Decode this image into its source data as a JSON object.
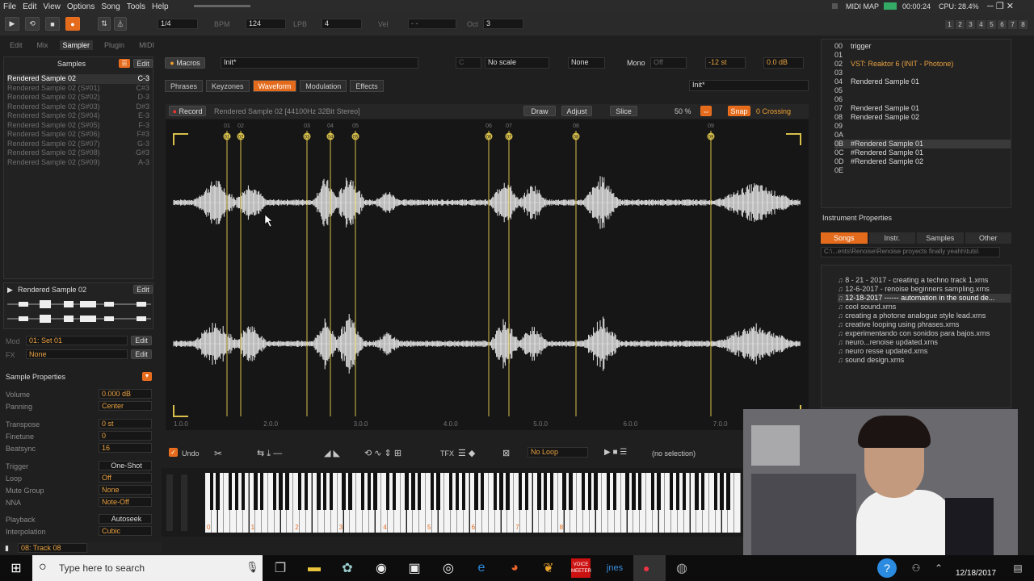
{
  "menu": [
    "File",
    "Edit",
    "View",
    "Options",
    "Song",
    "Tools",
    "Help"
  ],
  "transport": {
    "pattern": "1/4",
    "bpm_label": "BPM",
    "bpm": "124",
    "lpb_label": "LPB",
    "lpb": "4",
    "vel_label": "Vel",
    "vel": "- -",
    "oct_label": "Oct",
    "oct": "3",
    "midi_map": "MIDI MAP",
    "time": "00:00:24",
    "cpu": "CPU: 28.4%"
  },
  "track_numbers": [
    "1",
    "2",
    "3",
    "4",
    "5",
    "6",
    "7",
    "8"
  ],
  "left_tabs": [
    "Edit",
    "Mix",
    "Sampler",
    "Plugin",
    "MIDI"
  ],
  "samples_header": "Samples",
  "samples_edit": "Edit",
  "samples": [
    {
      "name": "Rendered Sample 02",
      "note": "C-3"
    },
    {
      "name": "Rendered Sample 02 (S#01)",
      "note": "C#3"
    },
    {
      "name": "Rendered Sample 02 (S#02)",
      "note": "D-3"
    },
    {
      "name": "Rendered Sample 02 (S#03)",
      "note": "D#3"
    },
    {
      "name": "Rendered Sample 02 (S#04)",
      "note": "E-3"
    },
    {
      "name": "Rendered Sample 02 (S#05)",
      "note": "F-3"
    },
    {
      "name": "Rendered Sample 02 (S#06)",
      "note": "F#3"
    },
    {
      "name": "Rendered Sample 02 (S#07)",
      "note": "G-3"
    },
    {
      "name": "Rendered Sample 02 (S#08)",
      "note": "G#3"
    },
    {
      "name": "Rendered Sample 02 (S#09)",
      "note": "A-3"
    }
  ],
  "preview": {
    "name": "Rendered Sample 02",
    "edit": "Edit"
  },
  "mod": {
    "label": "Mod",
    "value": "01: Set 01",
    "edit": "Edit"
  },
  "fx": {
    "label": "FX",
    "value": "None",
    "edit": "Edit"
  },
  "sample_props": {
    "title": "Sample Properties",
    "volume_l": "Volume",
    "volume": "0.000 dB",
    "panning_l": "Panning",
    "panning": "Center",
    "transpose_l": "Transpose",
    "transpose": "0 st",
    "finetune_l": "Finetune",
    "finetune": "0",
    "beatsync_l": "Beatsync",
    "beatsync": "16",
    "beatsync_t": "T",
    "trigger_l": "Trigger",
    "trigger": "One-Shot",
    "loop_l": "Loop",
    "loop": "Off",
    "mute_l": "Mute Group",
    "mute": "None",
    "nna_l": "NNA",
    "nna": "Note-Off",
    "playback_l": "Playback",
    "playback": "Autoseek",
    "interp_l": "Interpolation",
    "interp": "Cubic"
  },
  "instr_bar": {
    "macros": "Macros",
    "preset": "Init*",
    "scale_key": "C",
    "scale": "No scale",
    "none": "None",
    "mono": "Mono",
    "glide": "Off",
    "tune": "-12 st",
    "gain": "0.0 dB"
  },
  "sampler_tabs": [
    "Phrases",
    "Keyzones",
    "Waveform",
    "Modulation",
    "Effects"
  ],
  "sampler_preset": "Init*",
  "wave_toolbar": {
    "record": "Record",
    "info": "Rendered Sample 02 [44100Hz 32Bit Stereo]",
    "draw": "Draw",
    "adjust": "Adjust",
    "slice": "Slice",
    "zoom": "50 %",
    "snap": "Snap",
    "crossing": "0 Crossing"
  },
  "slice_labels": [
    "01",
    "02",
    "03",
    "04",
    "05",
    "06",
    "07",
    "08",
    "09"
  ],
  "ruler": [
    "1.0.0",
    "2.0.0",
    "3.0.0",
    "4.0.0",
    "5.0.0",
    "6.0.0",
    "7.0.0"
  ],
  "bottom_toolbar": {
    "undo": "Undo",
    "tfx": "TFX",
    "loop": "No Loop",
    "selection": "(no selection)"
  },
  "octaves": [
    "0",
    "1",
    "2",
    "3",
    "4",
    "5",
    "6",
    "7",
    "8"
  ],
  "instr_list": [
    {
      "num": "00",
      "name": "trigger"
    },
    {
      "num": "01",
      "name": ""
    },
    {
      "num": "02",
      "name": "VST: Reaktor 6 (INIT - Photone)"
    },
    {
      "num": "03",
      "name": ""
    },
    {
      "num": "04",
      "name": "Rendered Sample 01"
    },
    {
      "num": "05",
      "name": ""
    },
    {
      "num": "06",
      "name": ""
    },
    {
      "num": "07",
      "name": "Rendered Sample 01"
    },
    {
      "num": "08",
      "name": "Rendered Sample 02"
    },
    {
      "num": "09",
      "name": ""
    },
    {
      "num": "0A",
      "name": ""
    },
    {
      "num": "0B",
      "name": "#Rendered Sample 01"
    },
    {
      "num": "0C",
      "name": "#Rendered Sample 01"
    },
    {
      "num": "0D",
      "name": "#Rendered Sample 02"
    },
    {
      "num": "0E",
      "name": ""
    }
  ],
  "instr_props": "Instrument Properties",
  "browser_tabs": [
    "Songs",
    "Instr.",
    "Samples",
    "Other"
  ],
  "browser_path": "C:\\...ents\\Renoise\\Renoise proyects finally yeahh\\tuts\\",
  "files": [
    "8 - 21 - 2017 - creating a techno track 1.xrns",
    "12-6-2017 - renoise beginners sampling.xrns",
    "12-18-2017 ------ automation in the sound de...",
    "cool sound.xrns",
    "creating a photone analogue style lead.xrns",
    "creative looping using phrases.xrns",
    "experimentando con sonidos para bajos.xrns",
    "neuro...renoise updated.xrns",
    "neuro resse updated.xrns",
    "sound design.xrns"
  ],
  "status": {
    "track": "08: Track 08"
  },
  "taskbar": {
    "search": "Type here to search",
    "date": "12/18/2017",
    "voicemeeter": "VOICE MEETER",
    "jnes": "jnes"
  },
  "colors": {
    "accent": "#e36b1b",
    "waveform": "#e6e6e6",
    "slice_marker": "#d8c04a"
  }
}
